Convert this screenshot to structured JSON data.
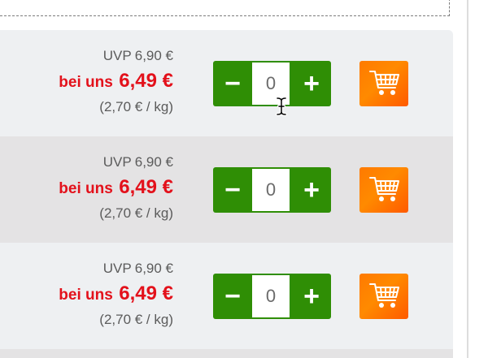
{
  "colors": {
    "accent_red": "#e3111b",
    "stepper_green": "#2f8e05",
    "cart_orange": "#ff7a00",
    "row_light": "#eef0f2",
    "row_dark": "#e4e3e4"
  },
  "products": [
    {
      "uvp_label": "UVP",
      "uvp_value": "6,90 €",
      "price_label": "bei uns",
      "price_value": "6,49 €",
      "unit_price": "(2,70 € / kg)",
      "quantity": "0",
      "minus_label": "−",
      "plus_label": "+",
      "cart_icon": "shopping-cart-icon"
    },
    {
      "uvp_label": "UVP",
      "uvp_value": "6,90 €",
      "price_label": "bei uns",
      "price_value": "6,49 €",
      "unit_price": "(2,70 € / kg)",
      "quantity": "0",
      "minus_label": "−",
      "plus_label": "+",
      "cart_icon": "shopping-cart-icon"
    },
    {
      "uvp_label": "UVP",
      "uvp_value": "6,90 €",
      "price_label": "bei uns",
      "price_value": "6,49 €",
      "unit_price": "(2,70 € / kg)",
      "quantity": "0",
      "minus_label": "−",
      "plus_label": "+",
      "cart_icon": "shopping-cart-icon"
    }
  ]
}
